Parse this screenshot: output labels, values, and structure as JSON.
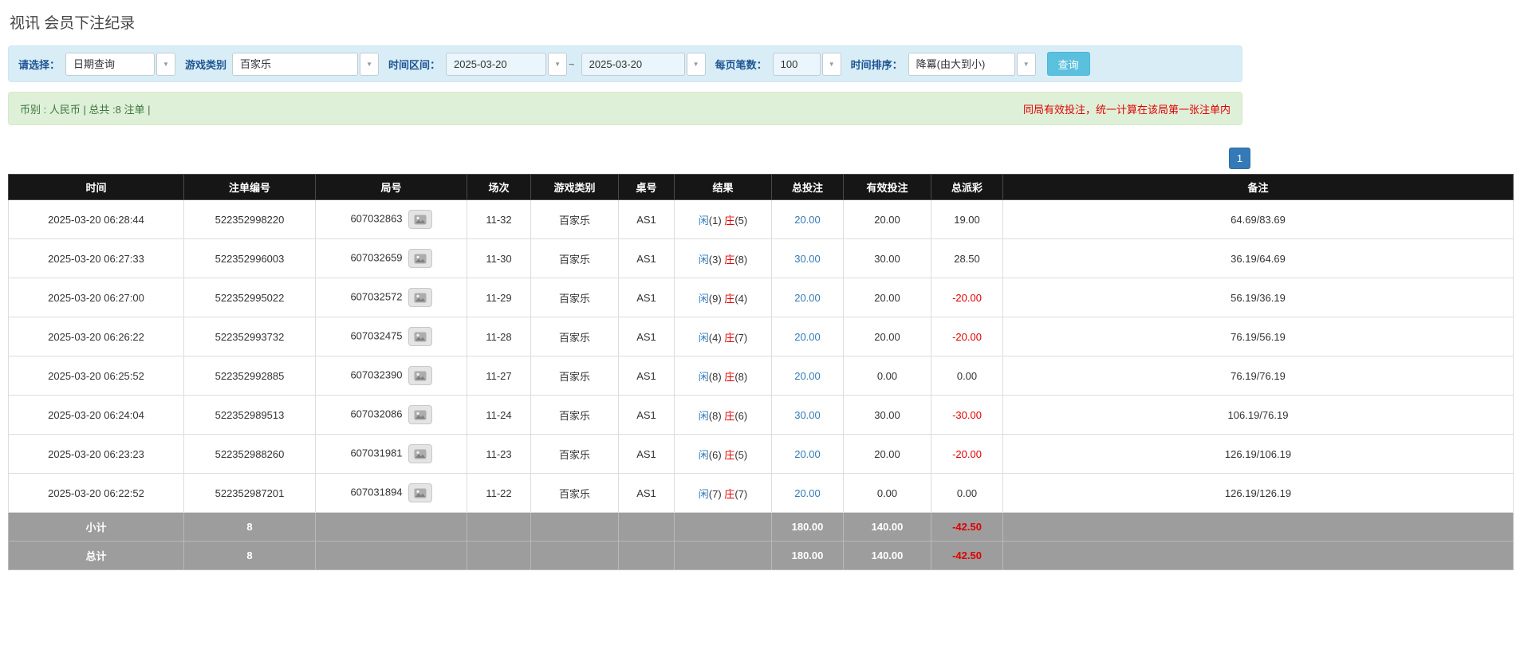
{
  "colors": {
    "label_blue": "#1e5593",
    "accent_blue": "#337ab7",
    "player_blue": "#337ab7",
    "banker_red": "#e00000",
    "negative_red": "#e00000",
    "filter_bg": "#d9edf7",
    "summary_bg": "#dff0d8",
    "summary_text_green": "#3c763d",
    "notice_red": "#e00000",
    "table_header_bg": "#161616",
    "table_footer_bg": "#9d9d9d",
    "search_button_bg": "#5bc0de",
    "pagination_bg": "#337ab7"
  },
  "page": {
    "title": "视讯 会员下注纪录"
  },
  "filters": {
    "select_label": "请选择：",
    "select_value": "日期查询",
    "game_type_label": "游戏类别",
    "game_type_value": "百家乐",
    "range_label": "时间区间：",
    "date_from": "2025-03-20",
    "range_separator": "~",
    "date_to": "2025-03-20",
    "page_size_label": "每页笔数：",
    "page_size_value": "100",
    "sort_label": "时间排序：",
    "sort_value": "降冪(由大到小)",
    "search_label": "查询"
  },
  "summary": {
    "currency_info": "币别 : 人民币 | 总共 :8 注单 |",
    "notice": "同局有效投注，统一计算在该局第一张注单内"
  },
  "pagination": {
    "current": "1"
  },
  "table": {
    "headers": [
      "时间",
      "注单编号",
      "局号",
      "场次",
      "游戏类别",
      "桌号",
      "结果",
      "总投注",
      "有效投注",
      "总派彩",
      "备注"
    ],
    "result_labels": {
      "player": "闲",
      "banker": "庄"
    },
    "rows": [
      {
        "time": "2025-03-20 06:28:44",
        "bet_id": "522352998220",
        "round_id": "607032863",
        "session": "11-32",
        "game": "百家乐",
        "table": "AS1",
        "player": "1",
        "banker": "5",
        "total_bet": "20.00",
        "valid_bet": "20.00",
        "payout": "19.00",
        "note": "64.69/83.69"
      },
      {
        "time": "2025-03-20 06:27:33",
        "bet_id": "522352996003",
        "round_id": "607032659",
        "session": "11-30",
        "game": "百家乐",
        "table": "AS1",
        "player": "3",
        "banker": "8",
        "total_bet": "30.00",
        "valid_bet": "30.00",
        "payout": "28.50",
        "note": "36.19/64.69"
      },
      {
        "time": "2025-03-20 06:27:00",
        "bet_id": "522352995022",
        "round_id": "607032572",
        "session": "11-29",
        "game": "百家乐",
        "table": "AS1",
        "player": "9",
        "banker": "4",
        "total_bet": "20.00",
        "valid_bet": "20.00",
        "payout": "-20.00",
        "note": "56.19/36.19"
      },
      {
        "time": "2025-03-20 06:26:22",
        "bet_id": "522352993732",
        "round_id": "607032475",
        "session": "11-28",
        "game": "百家乐",
        "table": "AS1",
        "player": "4",
        "banker": "7",
        "total_bet": "20.00",
        "valid_bet": "20.00",
        "payout": "-20.00",
        "note": "76.19/56.19"
      },
      {
        "time": "2025-03-20 06:25:52",
        "bet_id": "522352992885",
        "round_id": "607032390",
        "session": "11-27",
        "game": "百家乐",
        "table": "AS1",
        "player": "8",
        "banker": "8",
        "total_bet": "20.00",
        "valid_bet": "0.00",
        "payout": "0.00",
        "note": "76.19/76.19"
      },
      {
        "time": "2025-03-20 06:24:04",
        "bet_id": "522352989513",
        "round_id": "607032086",
        "session": "11-24",
        "game": "百家乐",
        "table": "AS1",
        "player": "8",
        "banker": "6",
        "total_bet": "30.00",
        "valid_bet": "30.00",
        "payout": "-30.00",
        "note": "106.19/76.19"
      },
      {
        "time": "2025-03-20 06:23:23",
        "bet_id": "522352988260",
        "round_id": "607031981",
        "session": "11-23",
        "game": "百家乐",
        "table": "AS1",
        "player": "6",
        "banker": "5",
        "total_bet": "20.00",
        "valid_bet": "20.00",
        "payout": "-20.00",
        "note": "126.19/106.19"
      },
      {
        "time": "2025-03-20 06:22:52",
        "bet_id": "522352987201",
        "round_id": "607031894",
        "session": "11-22",
        "game": "百家乐",
        "table": "AS1",
        "player": "7",
        "banker": "7",
        "total_bet": "20.00",
        "valid_bet": "0.00",
        "payout": "0.00",
        "note": "126.19/126.19"
      }
    ],
    "subtotal": {
      "label": "小计",
      "count": "8",
      "total_bet": "180.00",
      "valid_bet": "140.00",
      "payout": "-42.50"
    },
    "total": {
      "label": "总计",
      "count": "8",
      "total_bet": "180.00",
      "valid_bet": "140.00",
      "payout": "-42.50"
    }
  }
}
